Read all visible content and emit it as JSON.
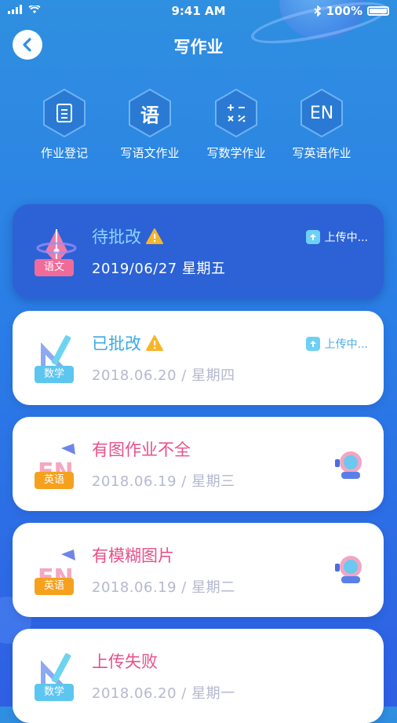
{
  "status_bar": {
    "time": "9:41 AM",
    "battery": "100%"
  },
  "nav": {
    "title": "写作业"
  },
  "shortcuts": [
    {
      "label": "作业登记",
      "glyph": "",
      "icon": "document-icon"
    },
    {
      "label": "写语文作业",
      "glyph": "语",
      "icon": "chinese-icon"
    },
    {
      "label": "写数学作业",
      "glyph": "",
      "icon": "math-icon"
    },
    {
      "label": "写英语作业",
      "glyph": "EN",
      "icon": "english-icon"
    }
  ],
  "cards": [
    {
      "title": "待批改",
      "date": "2019/06/27   星期五",
      "subject": "语文",
      "status": "上传中...",
      "title_color": "#ffffff",
      "badge_color": "#f06b9a"
    },
    {
      "title": "已批改",
      "date": "2018.06.20 / 星期四",
      "subject": "数学",
      "status": "上传中...",
      "title_color": "#3aa9e6",
      "badge_color": "#5cc6f0"
    },
    {
      "title": "有图作业不全",
      "date": "2018.06.19 / 星期三",
      "subject": "英语",
      "title_color": "#e8508a",
      "badge_color": "#f5a11e"
    },
    {
      "title": "有模糊图片",
      "date": "2018.06.19 / 星期二",
      "subject": "英语",
      "title_color": "#e8508a",
      "badge_color": "#f5a11e"
    },
    {
      "title": "上传失败",
      "date": "2018.06.20 / 星期一",
      "subject": "数学",
      "title_color": "#e8508a",
      "badge_color": "#5cc6f0"
    }
  ]
}
